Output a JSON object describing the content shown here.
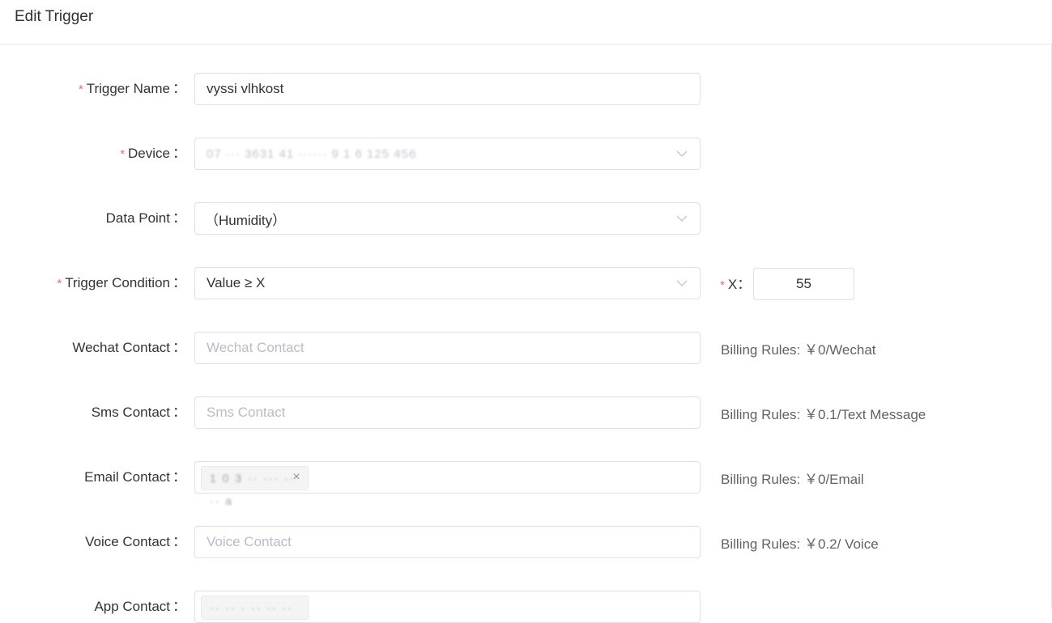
{
  "header": {
    "title": "Edit Trigger"
  },
  "form": {
    "trigger_name": {
      "label": "Trigger Name",
      "required": "*",
      "value": "vyssi vlhkost"
    },
    "device": {
      "label": "Device",
      "required": "*",
      "value": "07 ··· 3631 41 ······ 9 1 6 125 456"
    },
    "data_point": {
      "label": "Data Point",
      "value": "（Humidity）"
    },
    "trigger_condition": {
      "label": "Trigger Condition",
      "required": "*",
      "value": "Value ≥ X"
    },
    "x": {
      "label": "X",
      "required": "*",
      "value": "55"
    },
    "wechat_contact": {
      "label": "Wechat Contact",
      "placeholder": "Wechat Contact",
      "billing": "Billing Rules: ￥0/Wechat"
    },
    "sms_contact": {
      "label": "Sms Contact",
      "placeholder": "Sms Contact",
      "billing": "Billing Rules: ￥0.1/Text Message"
    },
    "email_contact": {
      "label": "Email Contact",
      "tag": "1 0 3 ·· ··· ·· ·· a",
      "tag_close": "×",
      "billing": "Billing Rules: ￥0/Email"
    },
    "voice_contact": {
      "label": "Voice Contact",
      "placeholder": "Voice Contact",
      "billing": "Billing Rules: ￥0.2/ Voice"
    },
    "app_contact": {
      "label": "App Contact",
      "tag": "·· ·· · ·· ·· ··"
    }
  },
  "colon": "："
}
